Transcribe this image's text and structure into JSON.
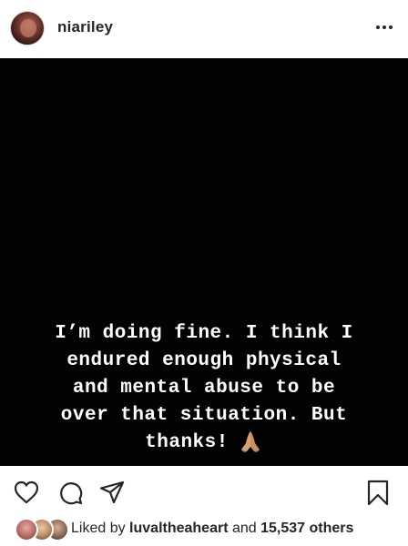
{
  "header": {
    "username": "niariley",
    "more_icon": "more-horizontal-icon"
  },
  "post": {
    "caption_lines": [
      "I’m doing fine. I think I",
      "endured enough physical",
      "and mental abuse to be",
      "over that situation. But",
      "thanks!"
    ],
    "emoji": "folded-hands-emoji"
  },
  "actions": {
    "like_icon": "heart-icon",
    "comment_icon": "comment-icon",
    "share_icon": "send-icon",
    "save_icon": "bookmark-icon"
  },
  "likes": {
    "prefix": "Liked by ",
    "user": "luvaltheaheart",
    "middle": " and ",
    "count": "15,537 others"
  },
  "colors": {
    "text": "#262626",
    "post_background": "#030303",
    "caption": "#ffffff"
  }
}
